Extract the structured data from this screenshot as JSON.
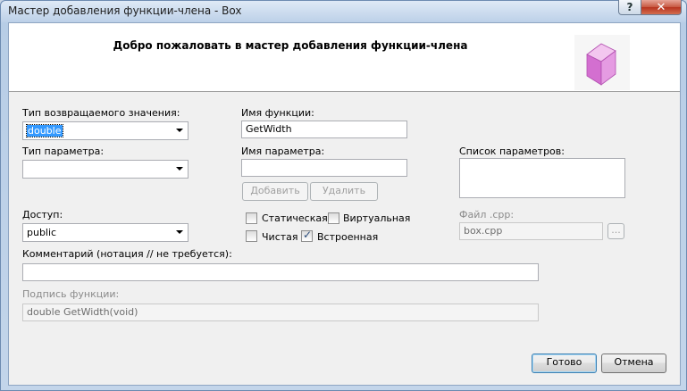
{
  "window": {
    "title": "Мастер добавления функции-члена - Box",
    "help_label": "?",
    "close_label": "✕"
  },
  "banner": {
    "title": "Добро пожаловать в мастер добавления функции-члена",
    "icon": "cube-icon"
  },
  "return_type": {
    "label": "Тип возвращаемого значения:",
    "value": "double"
  },
  "function_name": {
    "label": "Имя функции:",
    "value": "GetWidth"
  },
  "param_type": {
    "label": "Тип параметра:",
    "value": ""
  },
  "param_name": {
    "label": "Имя параметра:",
    "value": ""
  },
  "param_list": {
    "label": "Список параметров:"
  },
  "buttons": {
    "add": "Добавить",
    "remove": "Удалить",
    "browse": "...",
    "finish": "Готово",
    "cancel": "Отмена"
  },
  "access": {
    "label": "Доступ:",
    "value": "public"
  },
  "checkboxes": {
    "static": {
      "label": "Статическая",
      "checked": false
    },
    "virtual": {
      "label": "Виртуальная",
      "checked": false
    },
    "pure": {
      "label": "Чистая",
      "checked": false
    },
    "inline": {
      "label": "Встроенная",
      "checked": true
    }
  },
  "cpp_file": {
    "label": "Файл .cpp:",
    "value": "box.cpp"
  },
  "comment": {
    "label": "Комментарий (нотация // не требуется):",
    "value": ""
  },
  "signature": {
    "label": "Подпись функции:",
    "value": "double GetWidth(void)"
  },
  "colors": {
    "accent": "#3399ff",
    "banner_bg": "#ffffff",
    "dialog_bg": "#f0f0f0"
  }
}
